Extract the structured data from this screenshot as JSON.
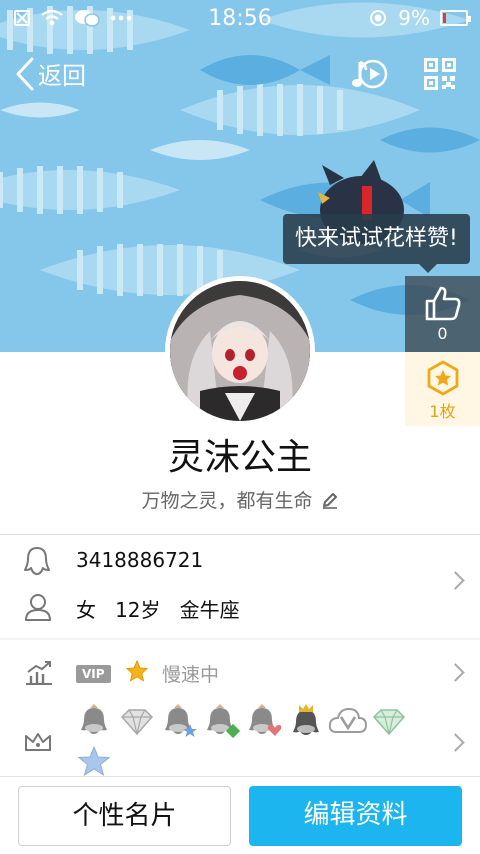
{
  "status_bar": {
    "time": "18:56",
    "battery": "9%"
  },
  "nav": {
    "back_label": "返回",
    "icons": [
      "back-icon",
      "music-icon",
      "qr-code-icon"
    ]
  },
  "cover": {
    "tooltip": "快来试试花样赞!",
    "like_count": "0",
    "medal_count": "1枚"
  },
  "profile": {
    "name": "灵沫公主",
    "signature": "万物之灵，都有生命"
  },
  "info": {
    "qq_number": "3418886721",
    "gender": "女",
    "age": "12岁",
    "zodiac": "金牛座"
  },
  "vip": {
    "badge": "VIP",
    "status": "慢速中"
  },
  "badges": [
    "penguin-badge",
    "diamond-badge",
    "penguin-star-badge",
    "penguin-green-badge",
    "penguin-heart-badge",
    "penguin-crown-badge",
    "cloud-v-badge",
    "green-diamond-badge",
    "blue-star-badge"
  ],
  "colors": {
    "accent": "#1cb5f0",
    "cover_bg": "#7ec4e8",
    "star": "#f5b21a"
  },
  "buttons": {
    "card": "个性名片",
    "edit": "编辑资料"
  }
}
